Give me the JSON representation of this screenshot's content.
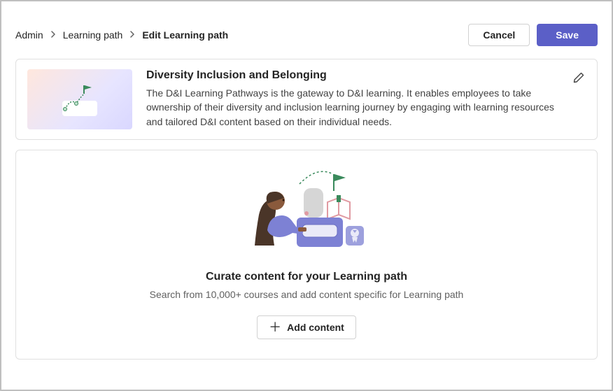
{
  "breadcrumb": {
    "root": "Admin",
    "mid": "Learning path",
    "current": "Edit Learning path"
  },
  "actions": {
    "cancel": "Cancel",
    "save": "Save"
  },
  "path": {
    "title": "Diversity Inclusion and Belonging",
    "description": "The D&I Learning Pathways is the gateway to D&I learning. It enables employees to take ownership of their diversity and inclusion learning journey by engaging with learning resources and tailored D&I content based on their individual needs."
  },
  "curate": {
    "title": "Curate content for your Learning path",
    "subtitle": "Search from 10,000+ courses and add content specific for Learning path",
    "add": "Add content"
  }
}
